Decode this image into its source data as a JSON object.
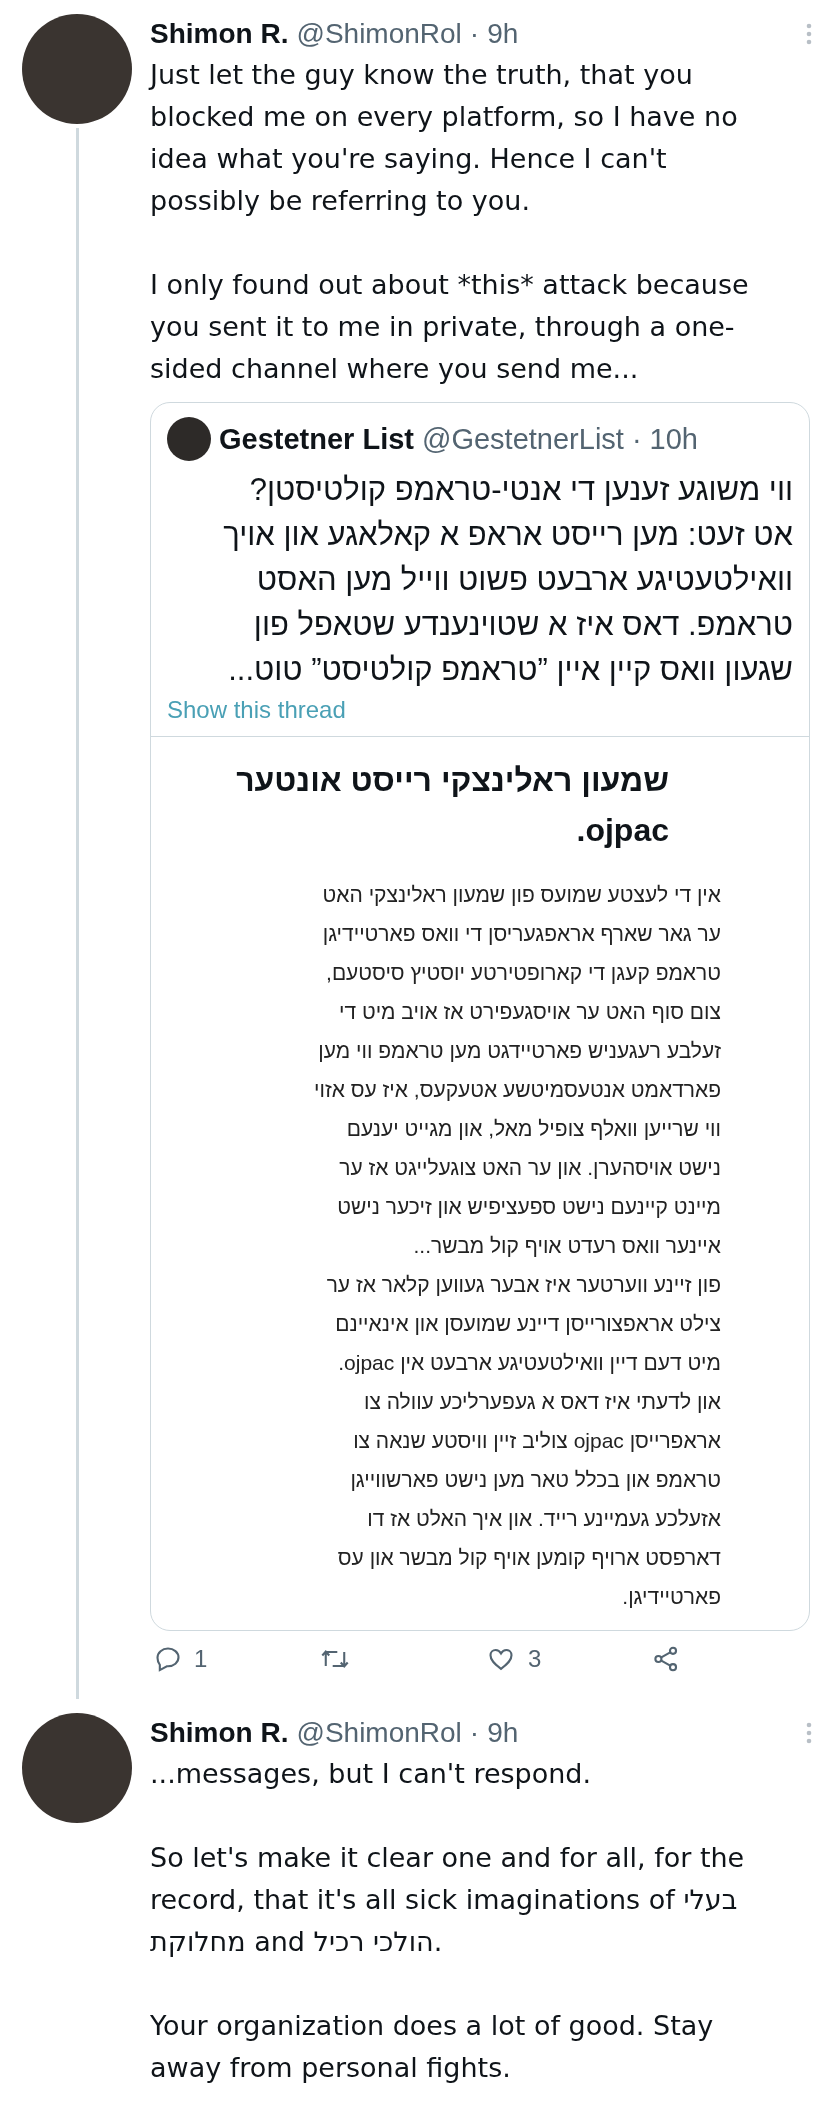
{
  "tweets": [
    {
      "name": "Shimon R.",
      "handle": "@ShimonRol",
      "separator": "·",
      "time": "9h",
      "paragraphs": [
        "Just let the guy know the truth, that you blocked me on every platform, so I have no idea what you're saying. Hence I can't possibly be referring to you.",
        "I only found out about *this* attack because you sent it to me in private, through a one-sided channel where you send me..."
      ],
      "quote": {
        "name": "Gestetner List",
        "handle": "@GestetnerList",
        "separator": "·",
        "time": "10h",
        "text": "ווי משוגע זענען די אנטי-טראמפ קולטיסטן?\nאט זעט: מען רייסט אראפ א קאלאגע און אויך\nוואילטעטיגע ארבעט פשוט ווייל מען האסט\nטראמפ. דאס איז א שטוינענדע שטאפל פון\nשגעון וואס קיין איין ”טראמפ קולטיסט” טוט...",
        "thread_link": "Show this thread",
        "document": {
          "title": "שמעון ראלינצקי רייסט אונטער\nojpac.",
          "lines": [
            "אין די לעצטע שמועס פון שמעון ראלינצקי האט",
            "ער גאר שארף אראפגעריסן די וואס פארטיידיגן",
            "טראמפ קעגן די קארופטירטע יוסטיץ סיסטעם,",
            "צום סוף האט ער אויסגעפירט אז אויב מיט די",
            "זעלבע רעגעניש פארטיידגט מען טראמפ ווי מען",
            "פארדאמט אנטעסמיטשע אטעקעס, איז עס אזוי",
            "ווי שרייען וואלף צופיל מאל, און מגייט יענעם",
            "נישט אויסהערן. און ער האט צוגעלייגט אז ער",
            "מיינט קיינעם נישט ספעציפיש און זיכער נישט",
            "איינער וואס רעדט אויף קול מבשר...",
            "פון זיינע ווערטער איז אבער געווען קלאר אז ער",
            "צילט אראפצורייסן דיינע שמועסן און אינאיינם",
            "מיט דעם דיין וואילטעטיגע ארבעט אין ojpac.",
            "און לדעתי איז דאס א געפערליכע עוולה צו",
            "אראפרייסן ojpac צוליב זיין וויסטע שנאה צו",
            "טראמפ און בכלל טאר מען נישט פארשווייגן",
            "אזעלכע געמיינע רייד. און איך האלט אז דו",
            "דארפסט ארויף קומען אויף קול מבשר און עס",
            "פארטיידיגן."
          ]
        }
      },
      "actions": {
        "reply_count": "1",
        "like_count": "3"
      }
    },
    {
      "name": "Shimon R.",
      "handle": "@ShimonRol",
      "separator": "·",
      "time": "9h",
      "paragraphs": [
        "...messages, but I can't respond.",
        "So let's make it clear one and for all, for the record, that it's all sick imaginations of בעלי מחלוקת and הולכי רכיל.",
        "Your organization does a lot of good. Stay away from personal fights."
      ]
    }
  ]
}
